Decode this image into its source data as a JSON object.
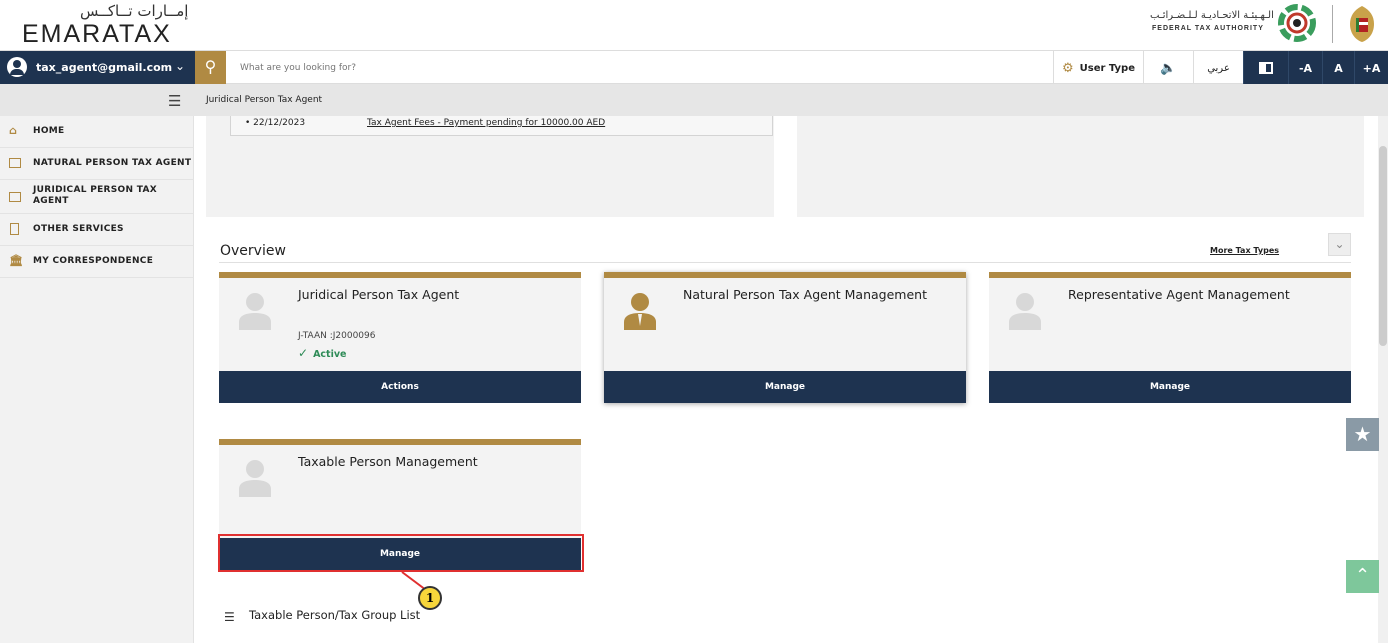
{
  "header": {
    "logo_ar": "إمــارات تــاكــس",
    "logo_en": "EMARATAX",
    "fta_ar": "الـهـيئـة الاتحـاديـة لـلـضـرائـب",
    "fta_en": "FEDERAL TAX AUTHORITY"
  },
  "toolbar": {
    "user_email": "tax_agent@gmail.com",
    "search_placeholder": "What are you looking for?",
    "user_type_label": "User Type",
    "arabic_label": "عربي",
    "font_decrease": "-A",
    "font_normal": "A",
    "font_increase": "+A"
  },
  "sidebar": {
    "items": [
      {
        "label": "HOME",
        "icon": "home-icon"
      },
      {
        "label": "NATURAL PERSON TAX AGENT",
        "icon": "id-card-icon"
      },
      {
        "label": "JURIDICAL PERSON TAX AGENT",
        "icon": "id-card-icon"
      },
      {
        "label": "OTHER SERVICES",
        "icon": "clipboard-icon"
      },
      {
        "label": "MY CORRESPONDENCE",
        "icon": "bank-icon"
      }
    ]
  },
  "breadcrumb": "Juridical Person Tax Agent",
  "notification": {
    "date": "• 22/12/2023",
    "text": "Tax Agent Fees - Payment pending for 10000.00 AED"
  },
  "overview": {
    "title": "Overview",
    "more_types": "More Tax Types",
    "cards": [
      {
        "title": "Juridical Person Tax Agent",
        "sub": "J-TAAN :J2000096",
        "status": "Active",
        "button": "Actions"
      },
      {
        "title": "Natural Person Tax Agent Management",
        "button": "Manage"
      },
      {
        "title": "Representative Agent Management",
        "button": "Manage"
      },
      {
        "title": "Taxable Person Management",
        "button": "Manage"
      }
    ],
    "list_link": "Taxable Person/Tax Group List",
    "callout_number": "1"
  },
  "colors": {
    "navy": "#1e3350",
    "gold": "#b08a43",
    "highlight": "#e03030"
  }
}
